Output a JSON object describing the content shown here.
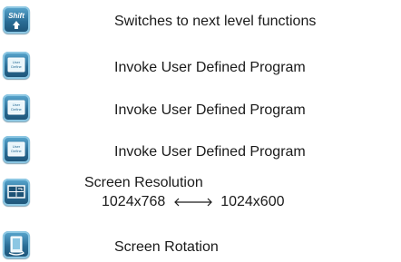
{
  "items": [
    {
      "icon": "shift-key-icon",
      "icon_text": "Shift",
      "label": "Switches to next level functions"
    },
    {
      "icon": "user-define-icon",
      "icon_text": "User Define",
      "label": "Invoke User Defined Program"
    },
    {
      "icon": "user-define-icon",
      "icon_text": "User Define",
      "label": "Invoke User Defined Program"
    },
    {
      "icon": "user-define-icon",
      "icon_text": "User Define",
      "label": "Invoke User Defined Program"
    },
    {
      "icon": "screen-resolution-icon",
      "label": "Screen Resolution",
      "from": "1024x768",
      "to": "1024x600"
    },
    {
      "icon": "screen-rotation-icon",
      "label": "Screen Rotation"
    }
  ]
}
